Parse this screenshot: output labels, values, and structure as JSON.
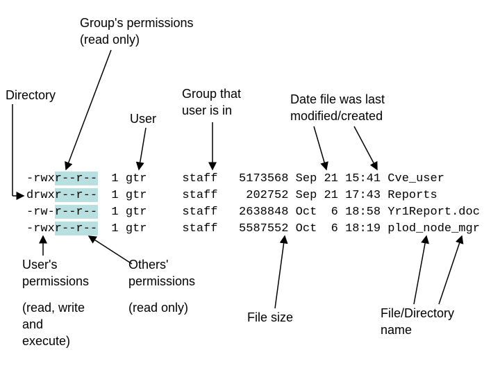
{
  "labels": {
    "group_perm_1": "Group's permissions",
    "group_perm_2": "(read only)",
    "directory": "Directory",
    "user": "User",
    "group_user_1": "Group that",
    "group_user_2": "user is in",
    "date_1": "Date file was last",
    "date_2": "modified/created",
    "user_perm_1": "User's",
    "user_perm_2": "permissions",
    "user_perm_3": "(read, write",
    "user_perm_4": "and",
    "user_perm_5": "execute)",
    "others_perm_1": "Others'",
    "others_perm_2": "permissions",
    "others_perm_3": "(read only)",
    "filesize": "File size",
    "fdname_1": "File/Directory",
    "fdname_2": "name"
  },
  "rows": [
    {
      "perm": "-rwxr--r--",
      "links": "1",
      "user": "gtr",
      "group": "staff",
      "size": "5173568",
      "month": "Sep",
      "day": "21",
      "time": "15:41",
      "name": "Cve_user"
    },
    {
      "perm": "drwxr--r--",
      "links": "1",
      "user": "gtr",
      "group": "staff",
      "size": " 202752",
      "month": "Sep",
      "day": "21",
      "time": "17:43",
      "name": "Reports"
    },
    {
      "perm": "-rw-r--r--",
      "links": "1",
      "user": "gtr",
      "group": "staff",
      "size": "2638848",
      "month": "Oct",
      "day": " 6",
      "time": "18:58",
      "name": "Yr1Report.doc"
    },
    {
      "perm": "-rwxr--r--",
      "links": "1",
      "user": "gtr",
      "group": "staff",
      "size": "5587552",
      "month": "Oct",
      "day": " 6",
      "time": "18:19",
      "name": "plod_node_mgr"
    }
  ]
}
